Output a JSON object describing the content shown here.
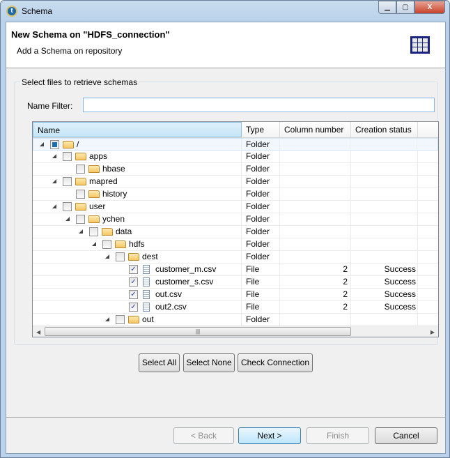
{
  "window": {
    "title": "Schema",
    "min": "▁",
    "max": "▢",
    "close": "X"
  },
  "header": {
    "title": "New Schema on \"HDFS_connection\"",
    "subtitle": "Add a Schema on repository"
  },
  "group": {
    "label": "Select files to retrieve schemas",
    "name_filter_label": "Name Filter:",
    "name_filter_value": ""
  },
  "table": {
    "columns": [
      "Name",
      "Type",
      "Column number",
      "Creation status",
      ""
    ],
    "rows": [
      {
        "name": "/",
        "type": "Folder",
        "level": 0,
        "kind": "folder",
        "expanded": true,
        "check": "partial"
      },
      {
        "name": "apps",
        "type": "Folder",
        "level": 1,
        "kind": "folder",
        "expanded": true,
        "check": "none"
      },
      {
        "name": "hbase",
        "type": "Folder",
        "level": 2,
        "kind": "folder",
        "expanded": false,
        "check": "none"
      },
      {
        "name": "mapred",
        "type": "Folder",
        "level": 1,
        "kind": "folder",
        "expanded": true,
        "check": "none"
      },
      {
        "name": "history",
        "type": "Folder",
        "level": 2,
        "kind": "folder",
        "expanded": false,
        "check": "none"
      },
      {
        "name": "user",
        "type": "Folder",
        "level": 1,
        "kind": "folder",
        "expanded": true,
        "check": "none"
      },
      {
        "name": "ychen",
        "type": "Folder",
        "level": 2,
        "kind": "folder",
        "expanded": true,
        "check": "none"
      },
      {
        "name": "data",
        "type": "Folder",
        "level": 3,
        "kind": "folder",
        "expanded": true,
        "check": "none"
      },
      {
        "name": "hdfs",
        "type": "Folder",
        "level": 4,
        "kind": "folder",
        "expanded": true,
        "check": "none"
      },
      {
        "name": "dest",
        "type": "Folder",
        "level": 5,
        "kind": "folder",
        "expanded": true,
        "check": "none"
      },
      {
        "name": "customer_m.csv",
        "type": "File",
        "level": 6,
        "kind": "file",
        "check": "checked",
        "columns": "2",
        "status": "Success"
      },
      {
        "name": "customer_s.csv",
        "type": "File",
        "level": 6,
        "kind": "file",
        "check": "checked",
        "columns": "2",
        "status": "Success"
      },
      {
        "name": "out.csv",
        "type": "File",
        "level": 6,
        "kind": "file",
        "check": "checked",
        "columns": "2",
        "status": "Success"
      },
      {
        "name": "out2.csv",
        "type": "File",
        "level": 6,
        "kind": "file",
        "check": "checked",
        "columns": "2",
        "status": "Success"
      },
      {
        "name": "out",
        "type": "Folder",
        "level": 5,
        "kind": "folder",
        "expanded": true,
        "check": "none"
      }
    ]
  },
  "actions": {
    "select_all": "Select All",
    "select_none": "Select None",
    "check_connection": "Check Connection"
  },
  "footer": {
    "back": "< Back",
    "next": "Next >",
    "finish": "Finish",
    "cancel": "Cancel"
  }
}
